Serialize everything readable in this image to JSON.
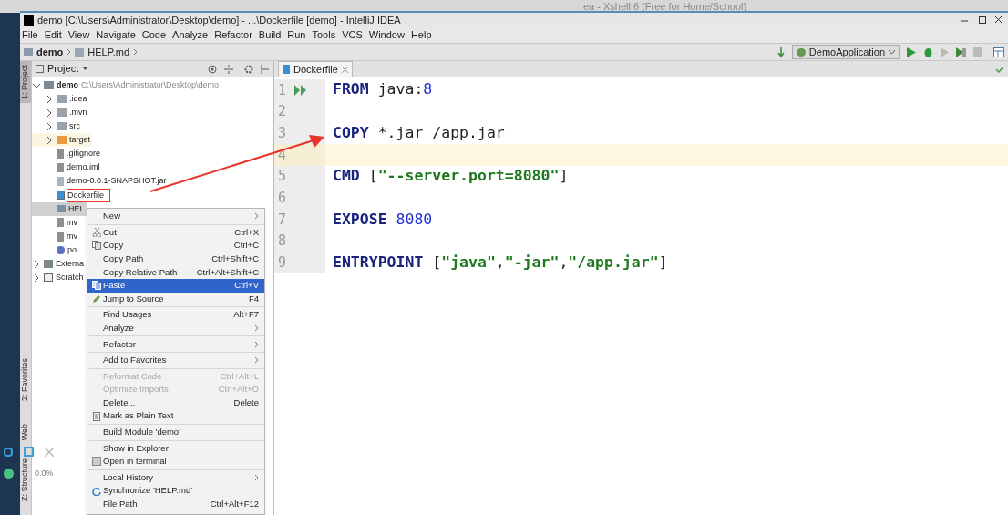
{
  "background_window": {
    "title": "ea - Xshell 6 (Free for Home/School)"
  },
  "window": {
    "title": "demo [C:\\Users\\Administrator\\Desktop\\demo] - ...\\Dockerfile [demo] - IntelliJ IDEA"
  },
  "menu": [
    "File",
    "Edit",
    "View",
    "Navigate",
    "Code",
    "Analyze",
    "Refactor",
    "Build",
    "Run",
    "Tools",
    "VCS",
    "Window",
    "Help"
  ],
  "breadcrumbs": [
    "demo",
    "HELP.md"
  ],
  "run_config": "DemoApplication",
  "tool_strip": [
    {
      "label": "1: Project",
      "selected": true
    },
    {
      "label": "2: Favorites",
      "selected": false
    },
    {
      "label": "Web",
      "selected": false
    },
    {
      "label": "Z: Structure",
      "selected": false
    }
  ],
  "project_panel": {
    "title": "Project",
    "tree": [
      {
        "label": "demo",
        "path": "C:\\Users\\Administrator\\Desktop\\demo",
        "kind": "module",
        "selected": false,
        "annotated": false,
        "expanded": true,
        "children": [
          {
            "label": ".idea",
            "kind": "folder",
            "selected": false,
            "annotated": false,
            "expanded": false
          },
          {
            "label": ".mvn",
            "kind": "folder",
            "selected": false,
            "annotated": false,
            "expanded": false
          },
          {
            "label": "src",
            "kind": "folder",
            "selected": false,
            "annotated": false,
            "expanded": false
          },
          {
            "label": "target",
            "kind": "excluded",
            "selected": false,
            "annotated": false,
            "expanded": false
          },
          {
            "label": ".gitignore",
            "kind": "file",
            "selected": false,
            "annotated": false
          },
          {
            "label": "demo.iml",
            "kind": "file",
            "selected": false,
            "annotated": false
          },
          {
            "label": "demo-0.0.1-SNAPSHOT.jar",
            "kind": "jar",
            "selected": false,
            "annotated": false
          },
          {
            "label": "Dockerfile",
            "kind": "docker",
            "selected": false,
            "annotated": true
          },
          {
            "label": "HEL",
            "kind": "markdown",
            "selected": true,
            "annotated": false
          },
          {
            "label": "mv",
            "kind": "file",
            "selected": false,
            "annotated": false
          },
          {
            "label": "mv",
            "kind": "file",
            "selected": false,
            "annotated": false
          },
          {
            "label": "po",
            "kind": "maven",
            "selected": false,
            "annotated": false
          }
        ]
      },
      {
        "label": "Externa",
        "kind": "library",
        "selected": false,
        "annotated": false,
        "expanded": false
      },
      {
        "label": "Scratch",
        "kind": "scratch",
        "selected": false,
        "annotated": false,
        "expanded": false
      }
    ]
  },
  "editor": {
    "tab": "Dockerfile",
    "lines": [
      {
        "number": "1",
        "current": false,
        "tokens": [
          {
            "kind": "keyword",
            "text": "FROM"
          },
          {
            "kind": "plain",
            "text": " java:"
          },
          {
            "kind": "number",
            "text": "8"
          }
        ]
      },
      {
        "number": "2",
        "current": false
      },
      {
        "number": "3",
        "current": false,
        "tokens": [
          {
            "kind": "keyword",
            "text": "COPY"
          },
          {
            "kind": "plain",
            "text": " *.jar /app.jar"
          }
        ]
      },
      {
        "number": "4",
        "current": true
      },
      {
        "number": "5",
        "current": false,
        "tokens": [
          {
            "kind": "keyword",
            "text": "CMD"
          },
          {
            "kind": "plain",
            "text": " ["
          },
          {
            "kind": "string",
            "text": "\"--server.port=8080\""
          },
          {
            "kind": "plain",
            "text": "]"
          }
        ]
      },
      {
        "number": "6",
        "current": false
      },
      {
        "number": "7",
        "current": false,
        "tokens": [
          {
            "kind": "keyword",
            "text": "EXPOSE"
          },
          {
            "kind": "number",
            "text": " 8080"
          }
        ]
      },
      {
        "number": "8",
        "current": false
      },
      {
        "number": "9",
        "current": false,
        "tokens": [
          {
            "kind": "keyword",
            "text": "ENTRYPOINT"
          },
          {
            "kind": "plain",
            "text": " ["
          },
          {
            "kind": "string",
            "text": "\"java\""
          },
          {
            "kind": "plain",
            "text": ","
          },
          {
            "kind": "string",
            "text": "\"-jar\""
          },
          {
            "kind": "plain",
            "text": ","
          },
          {
            "kind": "string",
            "text": "\"/app.jar\""
          },
          {
            "kind": "plain",
            "text": "]"
          }
        ]
      }
    ]
  },
  "context_menu": [
    [
      {
        "label": "New",
        "submenu": true,
        "disabled": false,
        "selected": false
      }
    ],
    [
      {
        "label": "Cut",
        "shortcut": "Ctrl+X",
        "submenu": false,
        "disabled": false,
        "selected": false
      },
      {
        "label": "Copy",
        "shortcut": "Ctrl+C",
        "submenu": false,
        "disabled": false,
        "selected": false
      },
      {
        "label": "Copy Path",
        "shortcut": "Ctrl+Shift+C",
        "submenu": false,
        "disabled": false,
        "selected": false
      },
      {
        "label": "Copy Relative Path",
        "shortcut": "Ctrl+Alt+Shift+C",
        "submenu": false,
        "disabled": false,
        "selected": false
      },
      {
        "label": "Paste",
        "shortcut": "Ctrl+V",
        "submenu": false,
        "disabled": false,
        "selected": true
      },
      {
        "label": "Jump to Source",
        "shortcut": "F4",
        "submenu": false,
        "disabled": false,
        "selected": false
      }
    ],
    [
      {
        "label": "Find Usages",
        "shortcut": "Alt+F7",
        "submenu": false,
        "disabled": false,
        "selected": false
      },
      {
        "label": "Analyze",
        "submenu": true,
        "disabled": false,
        "selected": false
      }
    ],
    [
      {
        "label": "Refactor",
        "submenu": true,
        "disabled": false,
        "selected": false
      }
    ],
    [
      {
        "label": "Add to Favorites",
        "submenu": true,
        "disabled": false,
        "selected": false
      }
    ],
    [
      {
        "label": "Reformat Code",
        "shortcut": "Ctrl+Alt+L",
        "submenu": false,
        "disabled": true,
        "selected": false
      },
      {
        "label": "Optimize Imports",
        "shortcut": "Ctrl+Alt+O",
        "submenu": false,
        "disabled": true,
        "selected": false
      },
      {
        "label": "Delete...",
        "shortcut": "Delete",
        "submenu": false,
        "disabled": false,
        "selected": false
      },
      {
        "label": "Mark as Plain Text",
        "submenu": false,
        "disabled": false,
        "selected": false
      }
    ],
    [
      {
        "label": "Build Module 'demo'",
        "submenu": false,
        "disabled": false,
        "selected": false
      }
    ],
    [
      {
        "label": "Show in Explorer",
        "submenu": false,
        "disabled": false,
        "selected": false
      },
      {
        "label": "Open in terminal",
        "submenu": false,
        "disabled": false,
        "selected": false
      }
    ],
    [
      {
        "label": "Local History",
        "submenu": true,
        "disabled": false,
        "selected": false
      },
      {
        "label": "Synchronize 'HELP.md'",
        "submenu": false,
        "disabled": false,
        "selected": false
      },
      {
        "label": "File Path",
        "shortcut": "Ctrl+Alt+F12",
        "submenu": false,
        "disabled": false,
        "selected": false
      }
    ]
  ],
  "recorder_widget": {
    "reading": "0.0%"
  }
}
